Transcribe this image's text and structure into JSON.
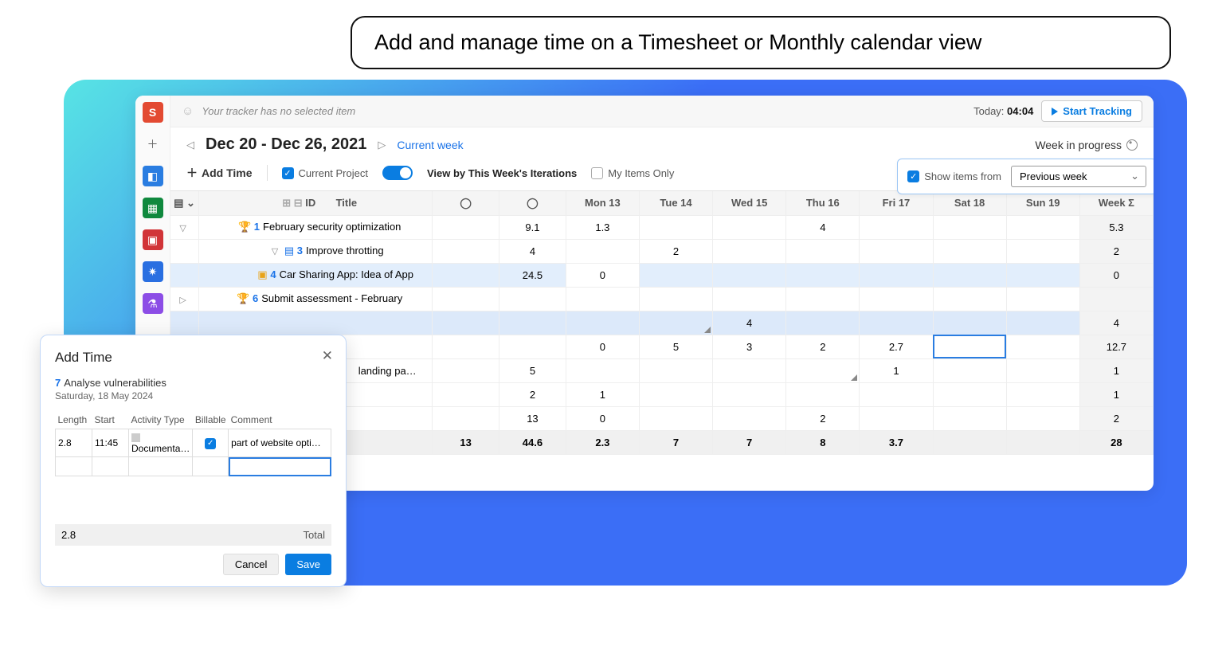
{
  "heading": "Add and manage time on a Timesheet or Monthly calendar view",
  "tracker": {
    "placeholder": "Your tracker has no selected item",
    "today_label": "Today:",
    "today_time": "04:04",
    "start_button": "Start Tracking"
  },
  "header": {
    "date_range": "Dec 20 - Dec 26, 2021",
    "current_week": "Current week",
    "week_status": "Week in progress"
  },
  "toolbar": {
    "add_time": "Add Time",
    "current_project": "Current Project",
    "view_by": "View by This Week's Iterations",
    "my_items": "My Items Only",
    "show_items_from": "Show items from",
    "previous_week": "Previous week"
  },
  "columns": {
    "id": "ID",
    "title": "Title",
    "mon": "Mon 13",
    "tue": "Tue 14",
    "wed": "Wed 15",
    "thu": "Thu 16",
    "fri": "Fri 17",
    "sat": "Sat 18",
    "sun": "Sun 19",
    "week": "Week Σ"
  },
  "rows": {
    "r1": {
      "id": "1",
      "title": "February security optimization",
      "c2": "9.1",
      "mon": "1.3",
      "thu": "4",
      "week": "5.3"
    },
    "r2": {
      "id": "3",
      "title": "Improve throtting",
      "c2": "4",
      "tue": "2",
      "week": "2"
    },
    "r3": {
      "id": "4",
      "title": "Car Sharing App: Idea of App",
      "c2": "24.5",
      "mon": "0",
      "week": "0"
    },
    "r4": {
      "id": "6",
      "title": "Submit assessment - February"
    },
    "r5": {
      "wed": "4",
      "week": "4"
    },
    "r6": {
      "mon": "0",
      "tue": "5",
      "wed": "3",
      "thu": "2",
      "fri": "2.7",
      "week": "12.7"
    },
    "r7": {
      "title_frag": "landing pa…",
      "c2": "5",
      "thu": "",
      "fri": "1",
      "week": "1"
    },
    "r8": {
      "c2": "2",
      "mon": "1",
      "week": "1"
    },
    "r9": {
      "c2": "13",
      "mon": "0",
      "thu": "2",
      "week": "2"
    },
    "footer": {
      "c1": "13",
      "c2": "44.6",
      "mon": "2.3",
      "tue": "7",
      "wed": "7",
      "thu": "8",
      "fri": "3.7",
      "week": "28"
    }
  },
  "dialog": {
    "title": "Add Time",
    "item_id": "7",
    "item_title": "Analyse vulnerabilities",
    "date": "Saturday, 18 May 2024",
    "cols": {
      "length": "Length",
      "start": "Start",
      "activity": "Activity Type",
      "billable": "Billable",
      "comment": "Comment"
    },
    "row1": {
      "length": "2.8",
      "start": "11:45",
      "activity": "Documenta…",
      "comment": "part of website opti…"
    },
    "total_value": "2.8",
    "total_label": "Total",
    "cancel": "Cancel",
    "save": "Save"
  }
}
